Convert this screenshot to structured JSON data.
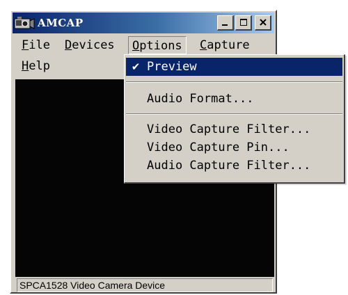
{
  "window": {
    "title": "AMCAP",
    "minimize_glyph": "_",
    "maximize_glyph": "□",
    "close_glyph": "X"
  },
  "menubar": {
    "items": [
      {
        "mnemonic": "F",
        "rest": "ile"
      },
      {
        "mnemonic": "D",
        "rest": "evices"
      },
      {
        "mnemonic": "O",
        "rest": "ptions"
      },
      {
        "mnemonic": "C",
        "rest": "apture"
      },
      {
        "mnemonic": "H",
        "rest": "elp"
      }
    ],
    "open_menu": "Options"
  },
  "options_menu": {
    "items": [
      {
        "label": "Preview",
        "checked": true,
        "check_glyph": "✔"
      },
      {
        "label": "Audio Format..."
      },
      {
        "label": "Video Capture Filter..."
      },
      {
        "label": "Video Capture Pin..."
      },
      {
        "label": "Audio Capture Filter..."
      }
    ]
  },
  "statusbar": {
    "text": "SPCA1528 Video Camera Device"
  },
  "colors": {
    "title_gradient_start": "#0a246a",
    "title_gradient_end": "#a6caf0",
    "menu_highlight": "#0a246a",
    "face": "#d4d0c8",
    "video_background": "#050505"
  },
  "icons": {
    "app": "camera-icon",
    "minimize": "minimize-icon",
    "maximize": "maximize-icon",
    "close": "close-icon",
    "check": "checkmark-icon"
  }
}
